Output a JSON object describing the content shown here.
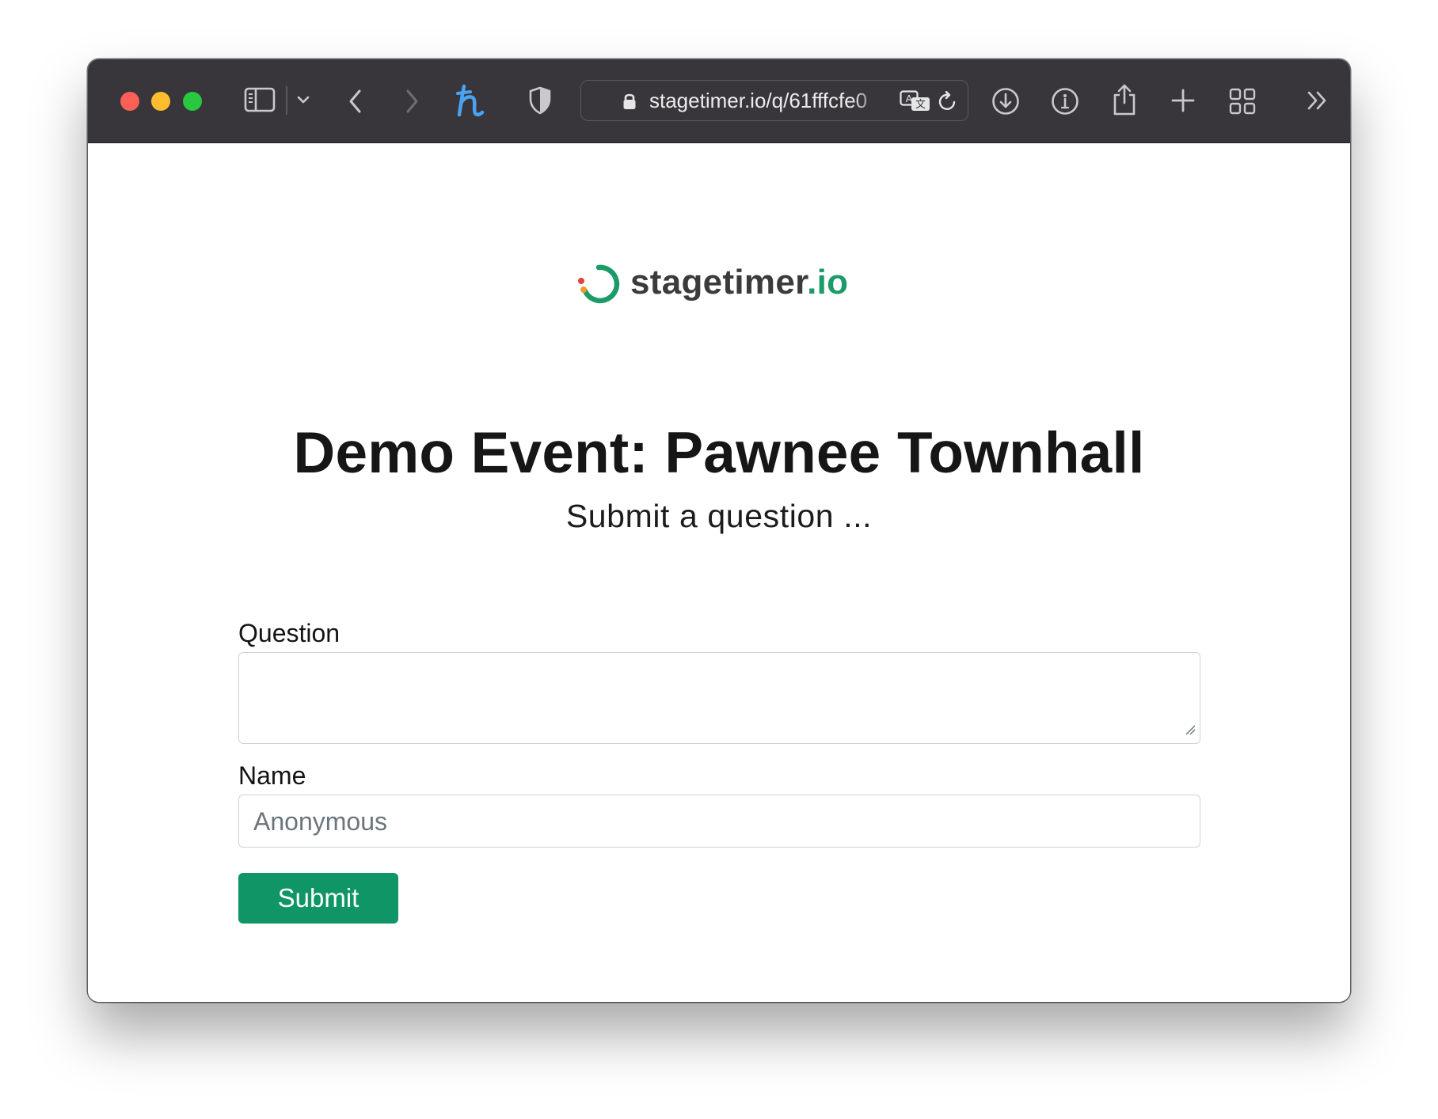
{
  "browser": {
    "url": "stagetimer.io/q/61fffcfe0",
    "traffic_lights": {
      "close": "#fe5f57",
      "minimize": "#febc2e",
      "zoom": "#28c840"
    }
  },
  "page": {
    "logo": {
      "name": "stagetimer",
      "tld": ".io",
      "brand_color": "#1a9b67"
    },
    "title": "Demo Event: Pawnee Townhall",
    "subtitle": "Submit a question ...",
    "form": {
      "question_label": "Question",
      "question_value": "",
      "name_label": "Name",
      "name_placeholder": "Anonymous",
      "submit_label": "Submit",
      "submit_color": "#0f9566"
    }
  },
  "icons": [
    "sidebar-icon",
    "chevron-down-icon",
    "back-icon",
    "forward-icon",
    "honey-extension-icon",
    "shield-icon",
    "lock-icon",
    "translate-icon",
    "reload-icon",
    "download-icon",
    "info-icon",
    "share-icon",
    "new-tab-icon",
    "tab-overview-icon",
    "more-icon"
  ]
}
